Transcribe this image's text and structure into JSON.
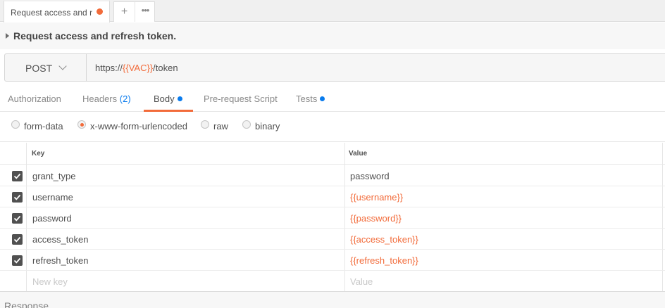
{
  "tab": {
    "label": "Request access and re",
    "dot_color": "#f26b3a",
    "plus_icon": "plus-icon",
    "more_icon": "more-icon"
  },
  "request": {
    "name": "Request access and refresh token."
  },
  "urlbar": {
    "method": "POST",
    "url_prefix": "https://",
    "url_variable": "{{VAC}}",
    "url_suffix": "/token"
  },
  "subtabs": [
    {
      "label": "Authorization"
    },
    {
      "label": "Headers",
      "count": "(2)"
    },
    {
      "label": "Body",
      "active": true,
      "dot": true
    },
    {
      "label": "Pre-request Script"
    },
    {
      "label": "Tests",
      "dot": true
    }
  ],
  "body_types": [
    {
      "label": "form-data",
      "selected": false
    },
    {
      "label": "x-www-form-urlencoded",
      "selected": true
    },
    {
      "label": "raw",
      "selected": false
    },
    {
      "label": "binary",
      "selected": false
    }
  ],
  "params_table": {
    "columns": [
      "Key",
      "Value"
    ],
    "rows": [
      {
        "checked": true,
        "key": "grant_type",
        "value": "password",
        "is_variable": false
      },
      {
        "checked": true,
        "key": "username",
        "value": "{{username}}",
        "is_variable": true
      },
      {
        "checked": true,
        "key": "password",
        "value": "{{password}}",
        "is_variable": true
      },
      {
        "checked": true,
        "key": "access_token",
        "value": "{{access_token}}",
        "is_variable": true
      },
      {
        "checked": true,
        "key": "refresh_token",
        "value": "{{refresh_token}}",
        "is_variable": true
      }
    ],
    "new_row": {
      "key_placeholder": "New key",
      "value_placeholder": "Value"
    }
  },
  "response": {
    "label": "Response"
  },
  "colors": {
    "accent": "#f26b3a",
    "count_blue": "#097bed"
  }
}
